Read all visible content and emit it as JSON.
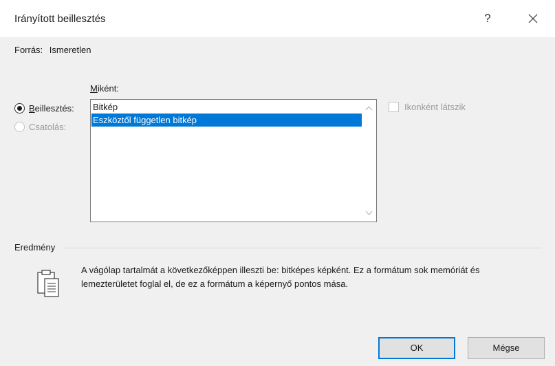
{
  "dialog": {
    "title": "Irányított beillesztés",
    "help_label": "?",
    "close_icon": "close-icon"
  },
  "source": {
    "label": "Forrás:",
    "value": "Ismeretlen"
  },
  "as_label_first": "M",
  "as_label_rest": "iként:",
  "options": {
    "paste_first": "B",
    "paste_rest": "eillesztés:",
    "paste_checked": true,
    "link_label": "Csatolás:",
    "link_enabled": false
  },
  "formats": {
    "items": [
      "Bitkép",
      "Eszköztől független bitkép"
    ],
    "selected_index": 1
  },
  "display_as_icon": {
    "label": "Ikonként látszik",
    "checked": false,
    "enabled": false
  },
  "result": {
    "heading": "Eredmény",
    "icon": "clipboard-icon",
    "text": "A vágólap tartalmát a következőképpen illeszti be: bitképes képként. Ez a formátum sok memóriát és lemezterületet foglal el, de ez a formátum a képernyő pontos mása."
  },
  "buttons": {
    "ok": "OK",
    "cancel": "Mégse"
  },
  "colors": {
    "selection": "#0078d7",
    "default_button_border": "#0078d7",
    "dialog_background": "#f0f0f0"
  }
}
